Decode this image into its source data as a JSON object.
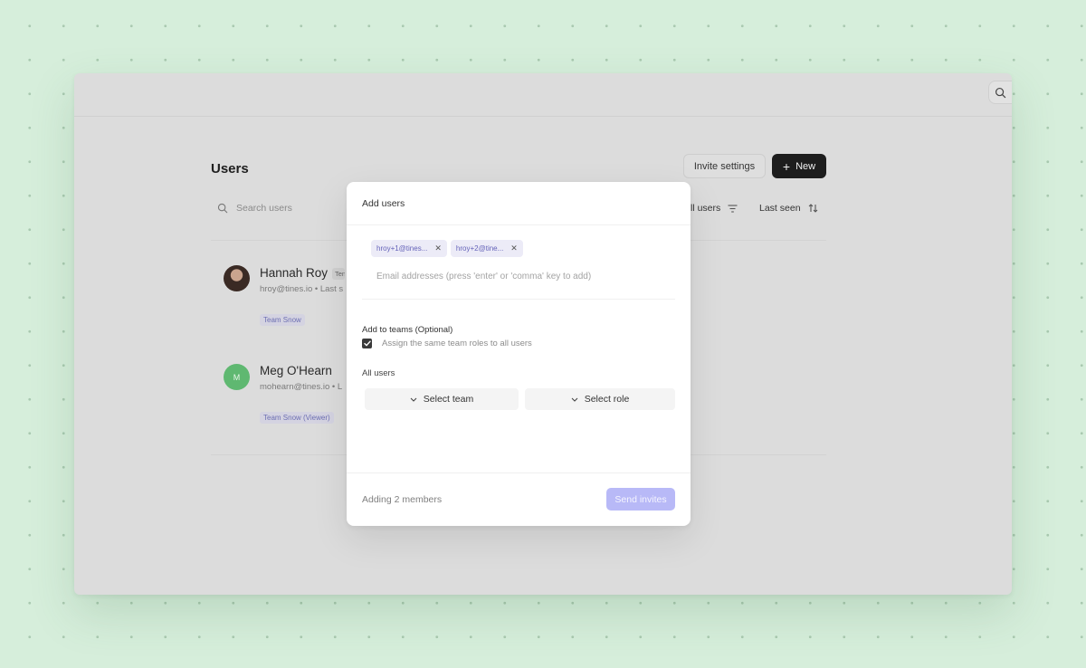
{
  "page": {
    "title": "Users",
    "invite_settings_label": "Invite settings",
    "new_button_label": "New",
    "search_placeholder": "Search users",
    "filter_label": "All users",
    "sort_label": "Last seen"
  },
  "users": [
    {
      "name": "Hannah Roy",
      "role_badge": "Ten",
      "meta": "hroy@tines.io  •  Last s",
      "team": "Team Snow",
      "avatar": "photo"
    },
    {
      "name": "Meg O'Hearn",
      "initial": "M",
      "meta": "mohearn@tines.io  •  L",
      "team": "Team Snow (Viewer)",
      "avatar_color": "#5fb871"
    }
  ],
  "modal": {
    "title": "Add users",
    "chips": [
      {
        "label": "hroy+1@tines..."
      },
      {
        "label": "hroy+2@tine..."
      }
    ],
    "email_placeholder": "Email addresses (press 'enter' or 'comma' key to add)",
    "teams_label": "Add to teams (Optional)",
    "checkbox_label": "Assign the same team roles to all users",
    "checkbox_checked": true,
    "all_users_label": "All users",
    "select_team_label": "Select team",
    "select_role_label": "Select role",
    "footer_status": "Adding 2 members",
    "send_label": "Send invites"
  },
  "colors": {
    "background": "#d6eedb",
    "accent_disabled": "#b8b9f7",
    "chip_text": "#6563b9"
  }
}
